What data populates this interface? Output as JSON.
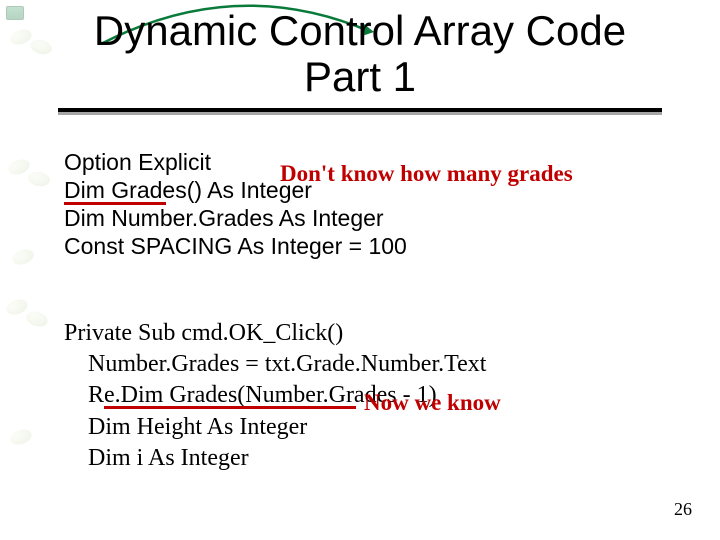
{
  "title_line1": "Dynamic Control Array Code",
  "title_line2": "Part 1",
  "code_block1": {
    "l1": "Option Explicit",
    "l2": "Dim Grades() As Integer",
    "l3": "Dim Number.Grades As Integer",
    "l4": "Const SPACING As Integer = 100"
  },
  "annotation1": "Don't know how many grades",
  "code_block2": {
    "l1": "Private Sub cmd.OK_Click()",
    "l2": "    Number.Grades = txt.Grade.Number.Text",
    "l3": "    Re.Dim Grades(Number.Grades - 1)",
    "l4": "    Dim Height As Integer",
    "l5": "    Dim i As Integer"
  },
  "annotation2": "Now we know",
  "page_number": "26"
}
